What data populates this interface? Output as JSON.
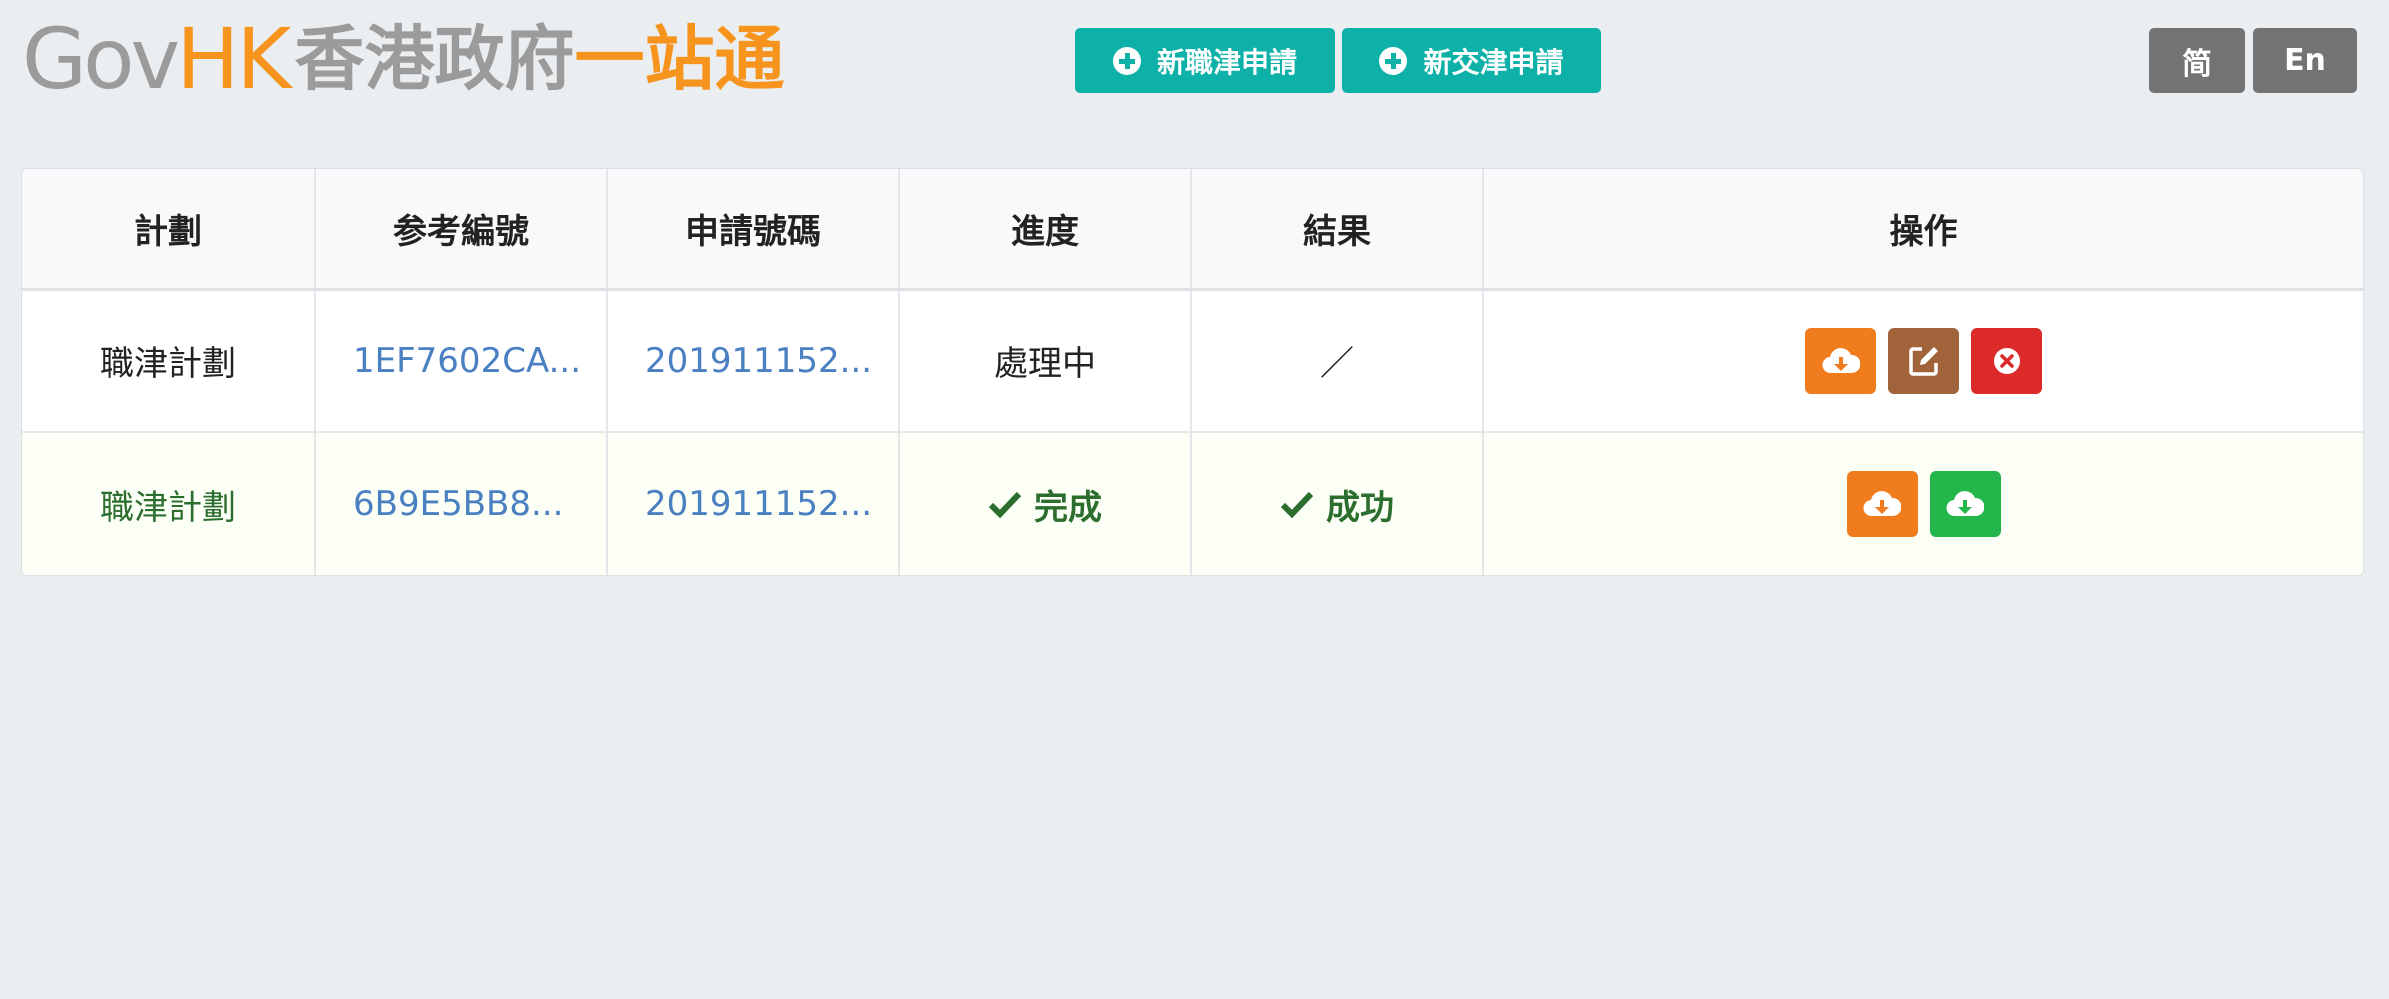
{
  "header": {
    "logo": {
      "gov": "Gov",
      "hk": "HK",
      "cn_grey": "香港政府",
      "cn_orange": "一站通"
    },
    "buttons": {
      "new_job_allowance": "新職津申請",
      "new_travel_allowance": "新交津申請"
    },
    "language": {
      "simplified": "简",
      "english": "En"
    }
  },
  "table": {
    "columns": [
      "計劃",
      "参考編號",
      "申請號碼",
      "進度",
      "結果",
      "操作"
    ],
    "rows": [
      {
        "scheme": "職津計劃",
        "reference_no": "1EF7602CA...",
        "application_no": "201911152...",
        "progress": "處理中",
        "result": "／",
        "actions": [
          "download-icon",
          "edit-icon",
          "cancel-icon"
        ]
      },
      {
        "scheme": "職津計劃",
        "reference_no": "6B9E5BB8...",
        "application_no": "201911152...",
        "progress": "完成",
        "result": "成功",
        "actions": [
          "download-icon",
          "download-result-icon"
        ]
      }
    ]
  },
  "colors": {
    "accent_teal": "#0eb1a8",
    "orange": "#f07c1e",
    "brown": "#a0633a",
    "red": "#dc2a2a",
    "green": "#25b64b",
    "link_blue": "#4a7fc1",
    "success_green": "#2b6e2d"
  }
}
